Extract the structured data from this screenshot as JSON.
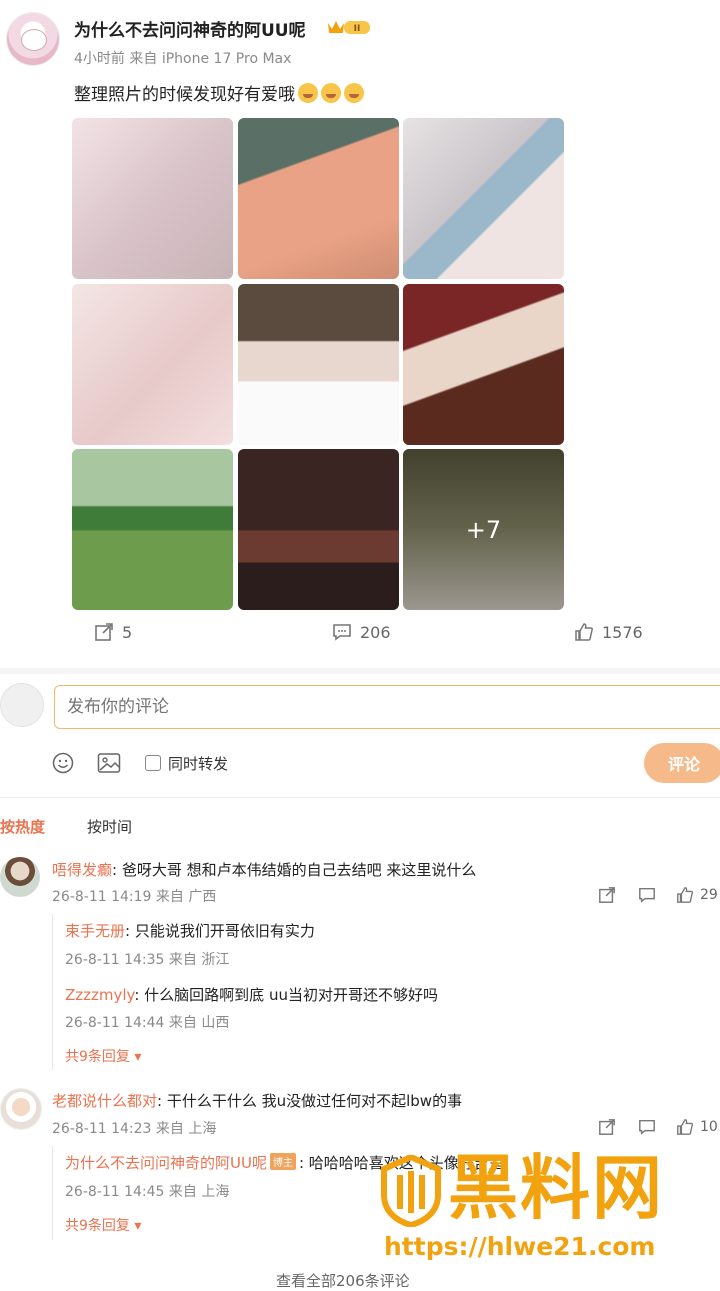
{
  "post": {
    "username": "为什么不去问问神奇的阿UU呢",
    "level_badge": "II",
    "time": "4小时前",
    "source": "来自 iPhone 17 Pro Max",
    "content": "整理照片的时候发现好有爱哦",
    "emoji_icons": [
      "smile-emoji-icon",
      "smile-emoji-icon",
      "smile-emoji-icon"
    ],
    "photos_more": "+7",
    "repost_count": "5",
    "comment_count": "206",
    "like_count": "1576"
  },
  "composer": {
    "placeholder": "发布你的评论",
    "repost_label": "同时转发",
    "submit_label": "评论"
  },
  "sort_tabs": {
    "hot": "按热度",
    "time": "按时间"
  },
  "comments": [
    {
      "name": "唔得发癫",
      "text": "爸呀大哥 想和卢本伟结婚的自己去结吧 来这里说什么",
      "time": "26-8-11 14:19 来自 广西",
      "likes": "29",
      "replies": [
        {
          "name": "束手无册",
          "text": "只能说我们开哥依旧有实力",
          "time": "26-8-11 14:35 来自 浙江"
        },
        {
          "name": "Zzzzmyly",
          "text": "什么脑回路啊到底 uu当初对开哥还不够好吗",
          "time": "26-8-11 14:44 来自 山西"
        }
      ],
      "more": "共9条回复"
    },
    {
      "name": "老都说什么都对",
      "text": "干什么干什么 我u没做过任何对不起lbw的事",
      "time": "26-8-11 14:23 来自 上海",
      "likes": "10",
      "replies": [
        {
          "name": "为什么不去问问神奇的阿UU呢",
          "badge": "博主",
          "text": "哈哈哈哈喜欢这个头像好吉呈",
          "time": "26-8-11 14:45 来自 上海"
        }
      ],
      "more": "共9条回复"
    }
  ],
  "footer_text": "查看全部206条评论",
  "watermark": {
    "title": "黑料网",
    "url": "https://hlwe21.com"
  },
  "colors": {
    "accent": "#eb7350",
    "submit": "#f6b98a",
    "watermark": "#f2a20e",
    "input_border": "#f0b969"
  }
}
